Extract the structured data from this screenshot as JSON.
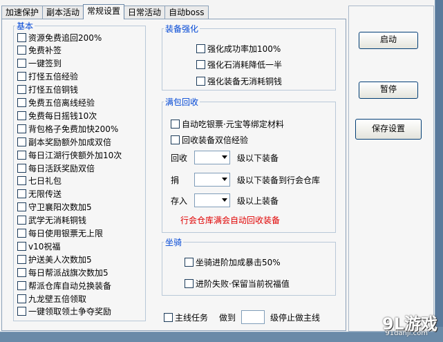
{
  "tabs": [
    "加速保护",
    "副本活动",
    "常规设置",
    "日常活动",
    "自动boss"
  ],
  "active_tab": 2,
  "basic": {
    "legend": "基本",
    "items": [
      "资源免费追回200%",
      "免费补签",
      "一键签到",
      "打怪五倍经验",
      "打怪五倍铜钱",
      "免费五倍离线经验",
      "免费每日摇钱10次",
      "背包格子免费加快200%",
      "副本奖励额外加成双倍",
      "每日江湖行侠额外加10次",
      "每日活跃奖励双倍",
      "七日礼包",
      "无限传送",
      "守卫襄阳次数加5",
      "武学无消耗铜钱",
      "每日使用银票无上限",
      "v10祝福",
      "护送美人次数加5",
      "每日帮派战旗次数加5",
      "帮派仓库自动兑换装备",
      "九龙壁五倍领取",
      "一键领取领土争夺奖励"
    ]
  },
  "equip": {
    "legend": "装备强化",
    "items": [
      "强化成功率加100%",
      "强化石消耗降低一半",
      "强化装备无消耗铜钱"
    ]
  },
  "bag": {
    "legend": "满包回收",
    "items": [
      "自动吃银票·元宝等绑定材料",
      "回收装备双倍经验"
    ],
    "rows": [
      {
        "label": "回收",
        "suffix": "级以下装备"
      },
      {
        "label": "捐",
        "suffix": "级以下装备到行会仓库"
      },
      {
        "label": "存入",
        "suffix": "级以上装备"
      }
    ],
    "note": "行会仓库满会自动回收装备"
  },
  "mount": {
    "legend": "坐骑",
    "items": [
      "坐骑进阶加成暴击50%",
      "进阶失败·保留当前祝福值"
    ]
  },
  "mainline": {
    "check_label": "主线任务",
    "to_label": "做到",
    "stop_label": "级停止做主线"
  },
  "buttons": {
    "start": "启动",
    "pause": "暂停",
    "save": "保存设置"
  },
  "watermark": {
    "main": "9L游戏",
    "sub": "91danji.com"
  }
}
